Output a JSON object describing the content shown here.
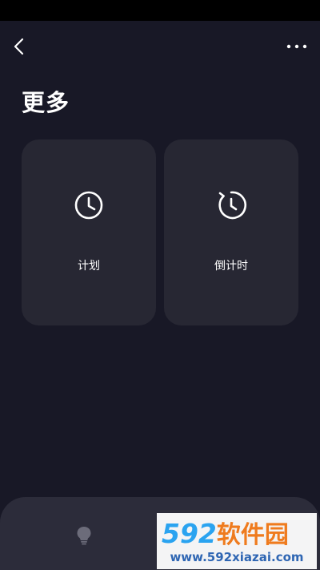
{
  "header": {
    "back_icon": "chevron-left-icon",
    "more_icon": "more-horizontal-icon",
    "title": "更多"
  },
  "cards": [
    {
      "label": "计划",
      "icon": "clock-icon"
    },
    {
      "label": "倒计时",
      "icon": "countdown-timer-icon"
    }
  ],
  "bottom_bar": {
    "icon": "lightbulb-icon"
  },
  "watermark": {
    "brand_number": "592",
    "brand_text": "软件园",
    "url": "www.592xiazai.com"
  },
  "colors": {
    "background": "#181826",
    "card": "#272733",
    "bottom_panel": "#2c2c3a",
    "text": "#ffffff"
  }
}
